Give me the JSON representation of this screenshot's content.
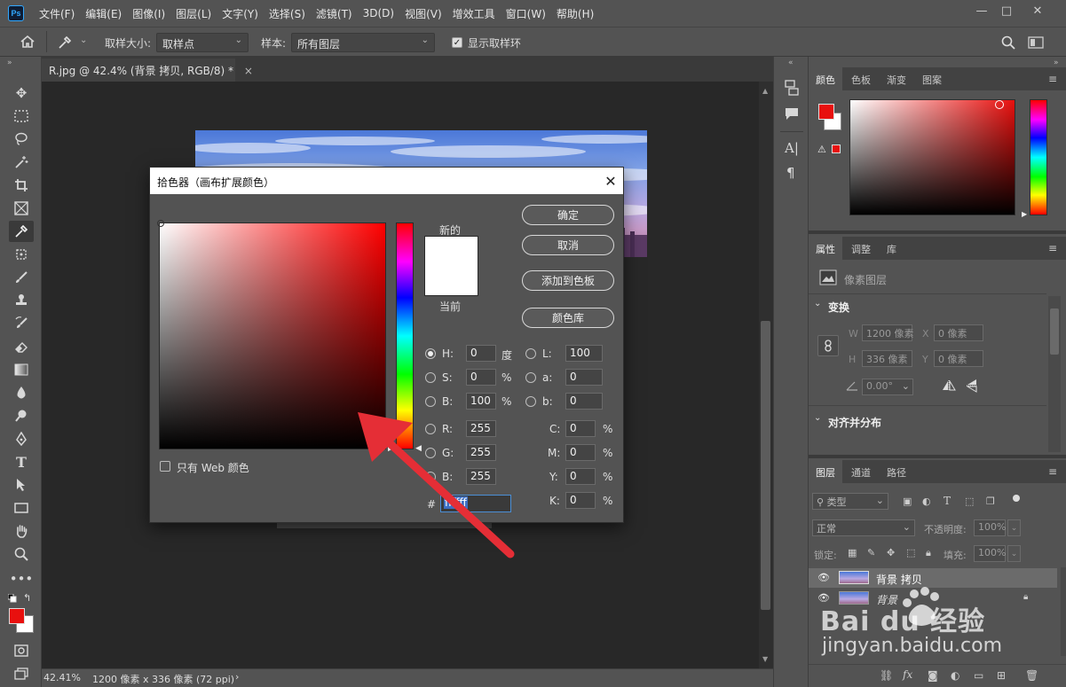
{
  "app": {
    "logo": "Ps",
    "accent": "#31a8ff"
  },
  "menu": [
    "文件(F)",
    "编辑(E)",
    "图像(I)",
    "图层(L)",
    "文字(Y)",
    "选择(S)",
    "滤镜(T)",
    "3D(D)",
    "视图(V)",
    "增效工具",
    "窗口(W)",
    "帮助(H)"
  ],
  "window": {
    "minimize": "—",
    "maximize": "□",
    "close": "✕"
  },
  "options": {
    "sample_size_label": "取样大小:",
    "sample_size_value": "取样点",
    "sample_label": "样本:",
    "sample_value": "所有图层",
    "show_ring_label": "显示取样环"
  },
  "document": {
    "tab_title": "R.jpg @ 42.4% (背景 拷贝, RGB/8) *",
    "tab_close": "×"
  },
  "status": {
    "zoom": "42.41%",
    "size": "1200 像素 x 336 像素 (72 ppi)",
    "arrow": "›"
  },
  "dialog": {
    "title": "拾色器（画布扩展颜色）",
    "close": "✕",
    "new_label": "新的",
    "current_label": "当前",
    "ok": "确定",
    "cancel": "取消",
    "add_swatch": "添加到色板",
    "color_libraries": "颜色库",
    "only_web": "只有 Web 颜色",
    "hex_label": "#",
    "hex_value": "ffffff",
    "new_color": "#ffffff",
    "current_color": "#ffffff",
    "hue_color": "#ff1010",
    "fields": {
      "H": {
        "label": "H:",
        "value": "0",
        "unit": "度"
      },
      "S": {
        "label": "S:",
        "value": "0",
        "unit": "%"
      },
      "Bv": {
        "label": "B:",
        "value": "100",
        "unit": "%"
      },
      "R": {
        "label": "R:",
        "value": "255"
      },
      "G": {
        "label": "G:",
        "value": "255"
      },
      "B": {
        "label": "B:",
        "value": "255"
      },
      "L": {
        "label": "L:",
        "value": "100"
      },
      "a": {
        "label": "a:",
        "value": "0"
      },
      "b": {
        "label": "b:",
        "value": "0"
      },
      "C": {
        "label": "C:",
        "value": "0",
        "unit": "%"
      },
      "M": {
        "label": "M:",
        "value": "0",
        "unit": "%"
      },
      "Y": {
        "label": "Y:",
        "value": "0",
        "unit": "%"
      },
      "K": {
        "label": "K:",
        "value": "0",
        "unit": "%"
      }
    }
  },
  "panels": {
    "color_tabs": [
      "颜色",
      "色板",
      "渐变",
      "图案"
    ],
    "props_tabs": [
      "属性",
      "调整",
      "库"
    ],
    "pixel_layer": "像素图层",
    "transform": "变换",
    "w_label": "W",
    "w_value": "1200 像素",
    "h_label": "H",
    "h_value": "336 像素",
    "x_label": "X",
    "x_value": "0 像素",
    "y_label": "Y",
    "y_value": "0 像素",
    "angle_value": "0.00°",
    "align": "对齐并分布",
    "layers_tabs": [
      "图层",
      "通道",
      "路径"
    ],
    "kind": "类型",
    "blend": "正常",
    "opacity_label": "不透明度:",
    "opacity_value": "100%",
    "lock_label": "锁定:",
    "fill_label": "填充:",
    "fill_value": "100%",
    "layers": [
      "背景 拷贝",
      "背景"
    ],
    "fg_color": "#e8100e",
    "bg_color": "#ffffff"
  },
  "watermark": {
    "brand": "Bai du 经验",
    "url": "jingyan.baidu.com"
  }
}
